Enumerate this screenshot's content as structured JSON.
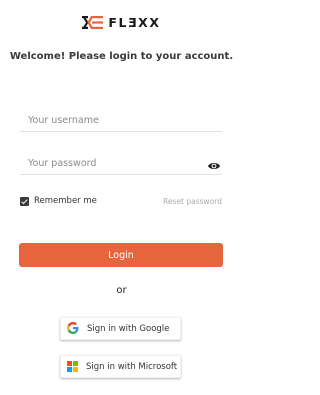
{
  "brand": {
    "logo_text": "FLƎXX",
    "accent_color": "#e8643c",
    "mark_color": "#e8643c",
    "text_color": "#1a1a1a"
  },
  "welcome": {
    "heading": "Welcome! Please login to your account."
  },
  "form": {
    "username": {
      "placeholder": "Your username",
      "value": ""
    },
    "password": {
      "placeholder": "Your password",
      "value": "",
      "toggle_icon": "eye-icon"
    },
    "remember_me": {
      "label": "Remember me",
      "checked": true
    },
    "reset_password_label": "Reset password",
    "login_label": "Login"
  },
  "divider_text": "or",
  "social": {
    "google": {
      "label": "Sign in with Google",
      "icon": "google-icon"
    },
    "microsoft": {
      "label": "Sign in with Microsoft",
      "icon": "microsoft-icon",
      "colors": [
        "#f25022",
        "#7fba00",
        "#00a4ef",
        "#ffb900"
      ]
    }
  }
}
